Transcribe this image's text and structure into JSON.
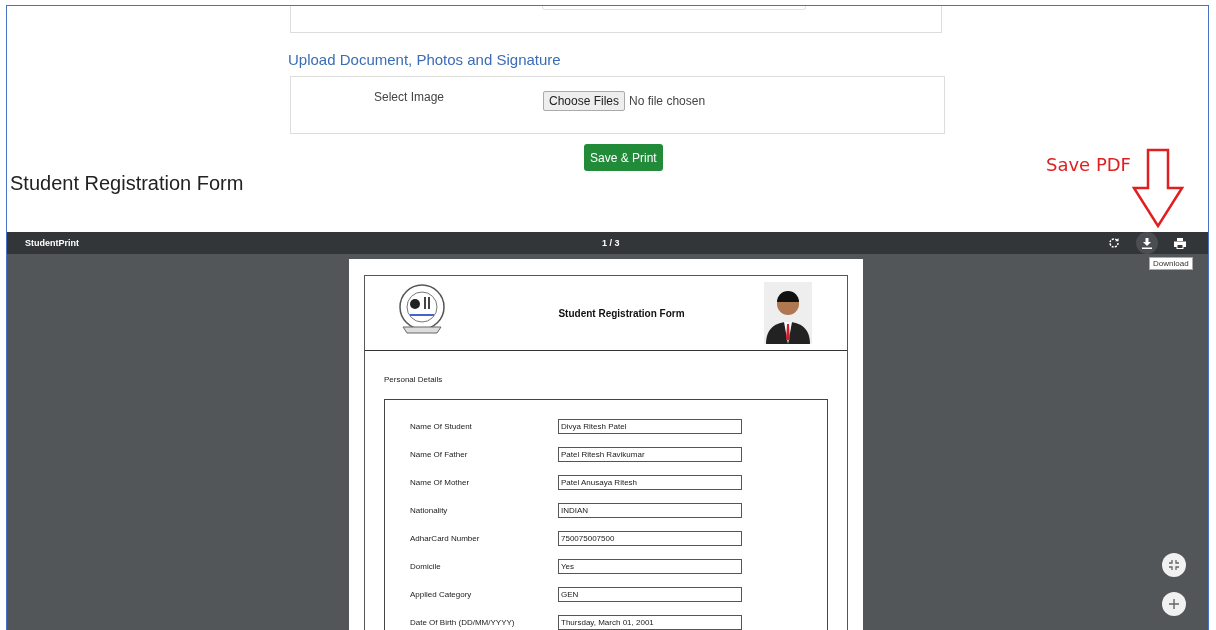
{
  "upload_section": {
    "heading": "Upload Document, Photos and Signature",
    "field_label": "Select Image",
    "file_button": "Choose Files",
    "file_status": "No file chosen"
  },
  "submit_button": "Save & Print",
  "page_heading": "Student Registration Form",
  "annotation": {
    "label": "Save PDF"
  },
  "pdf_viewer": {
    "title": "StudentPrint",
    "page_counter": "1 / 3",
    "tooltip": "Download",
    "document": {
      "title": "Student Registration Form",
      "section": "Personal Details",
      "fields": [
        {
          "label": "Name Of Student",
          "value": "Divya Ritesh Patel"
        },
        {
          "label": "Name Of Father",
          "value": "Patel Ritesh Ravikumar"
        },
        {
          "label": "Name Of Mother",
          "value": "Patel Anusaya Ritesh"
        },
        {
          "label": "Nationality",
          "value": "INDIAN"
        },
        {
          "label": "AdharCard Number",
          "value": "750075007500"
        },
        {
          "label": "Domicile",
          "value": "Yes"
        },
        {
          "label": "Applied Category",
          "value": "GEN"
        },
        {
          "label": "Date Of Birth (DD/MM/YYYY)",
          "value": "Thursday, March 01, 2001"
        }
      ]
    }
  }
}
